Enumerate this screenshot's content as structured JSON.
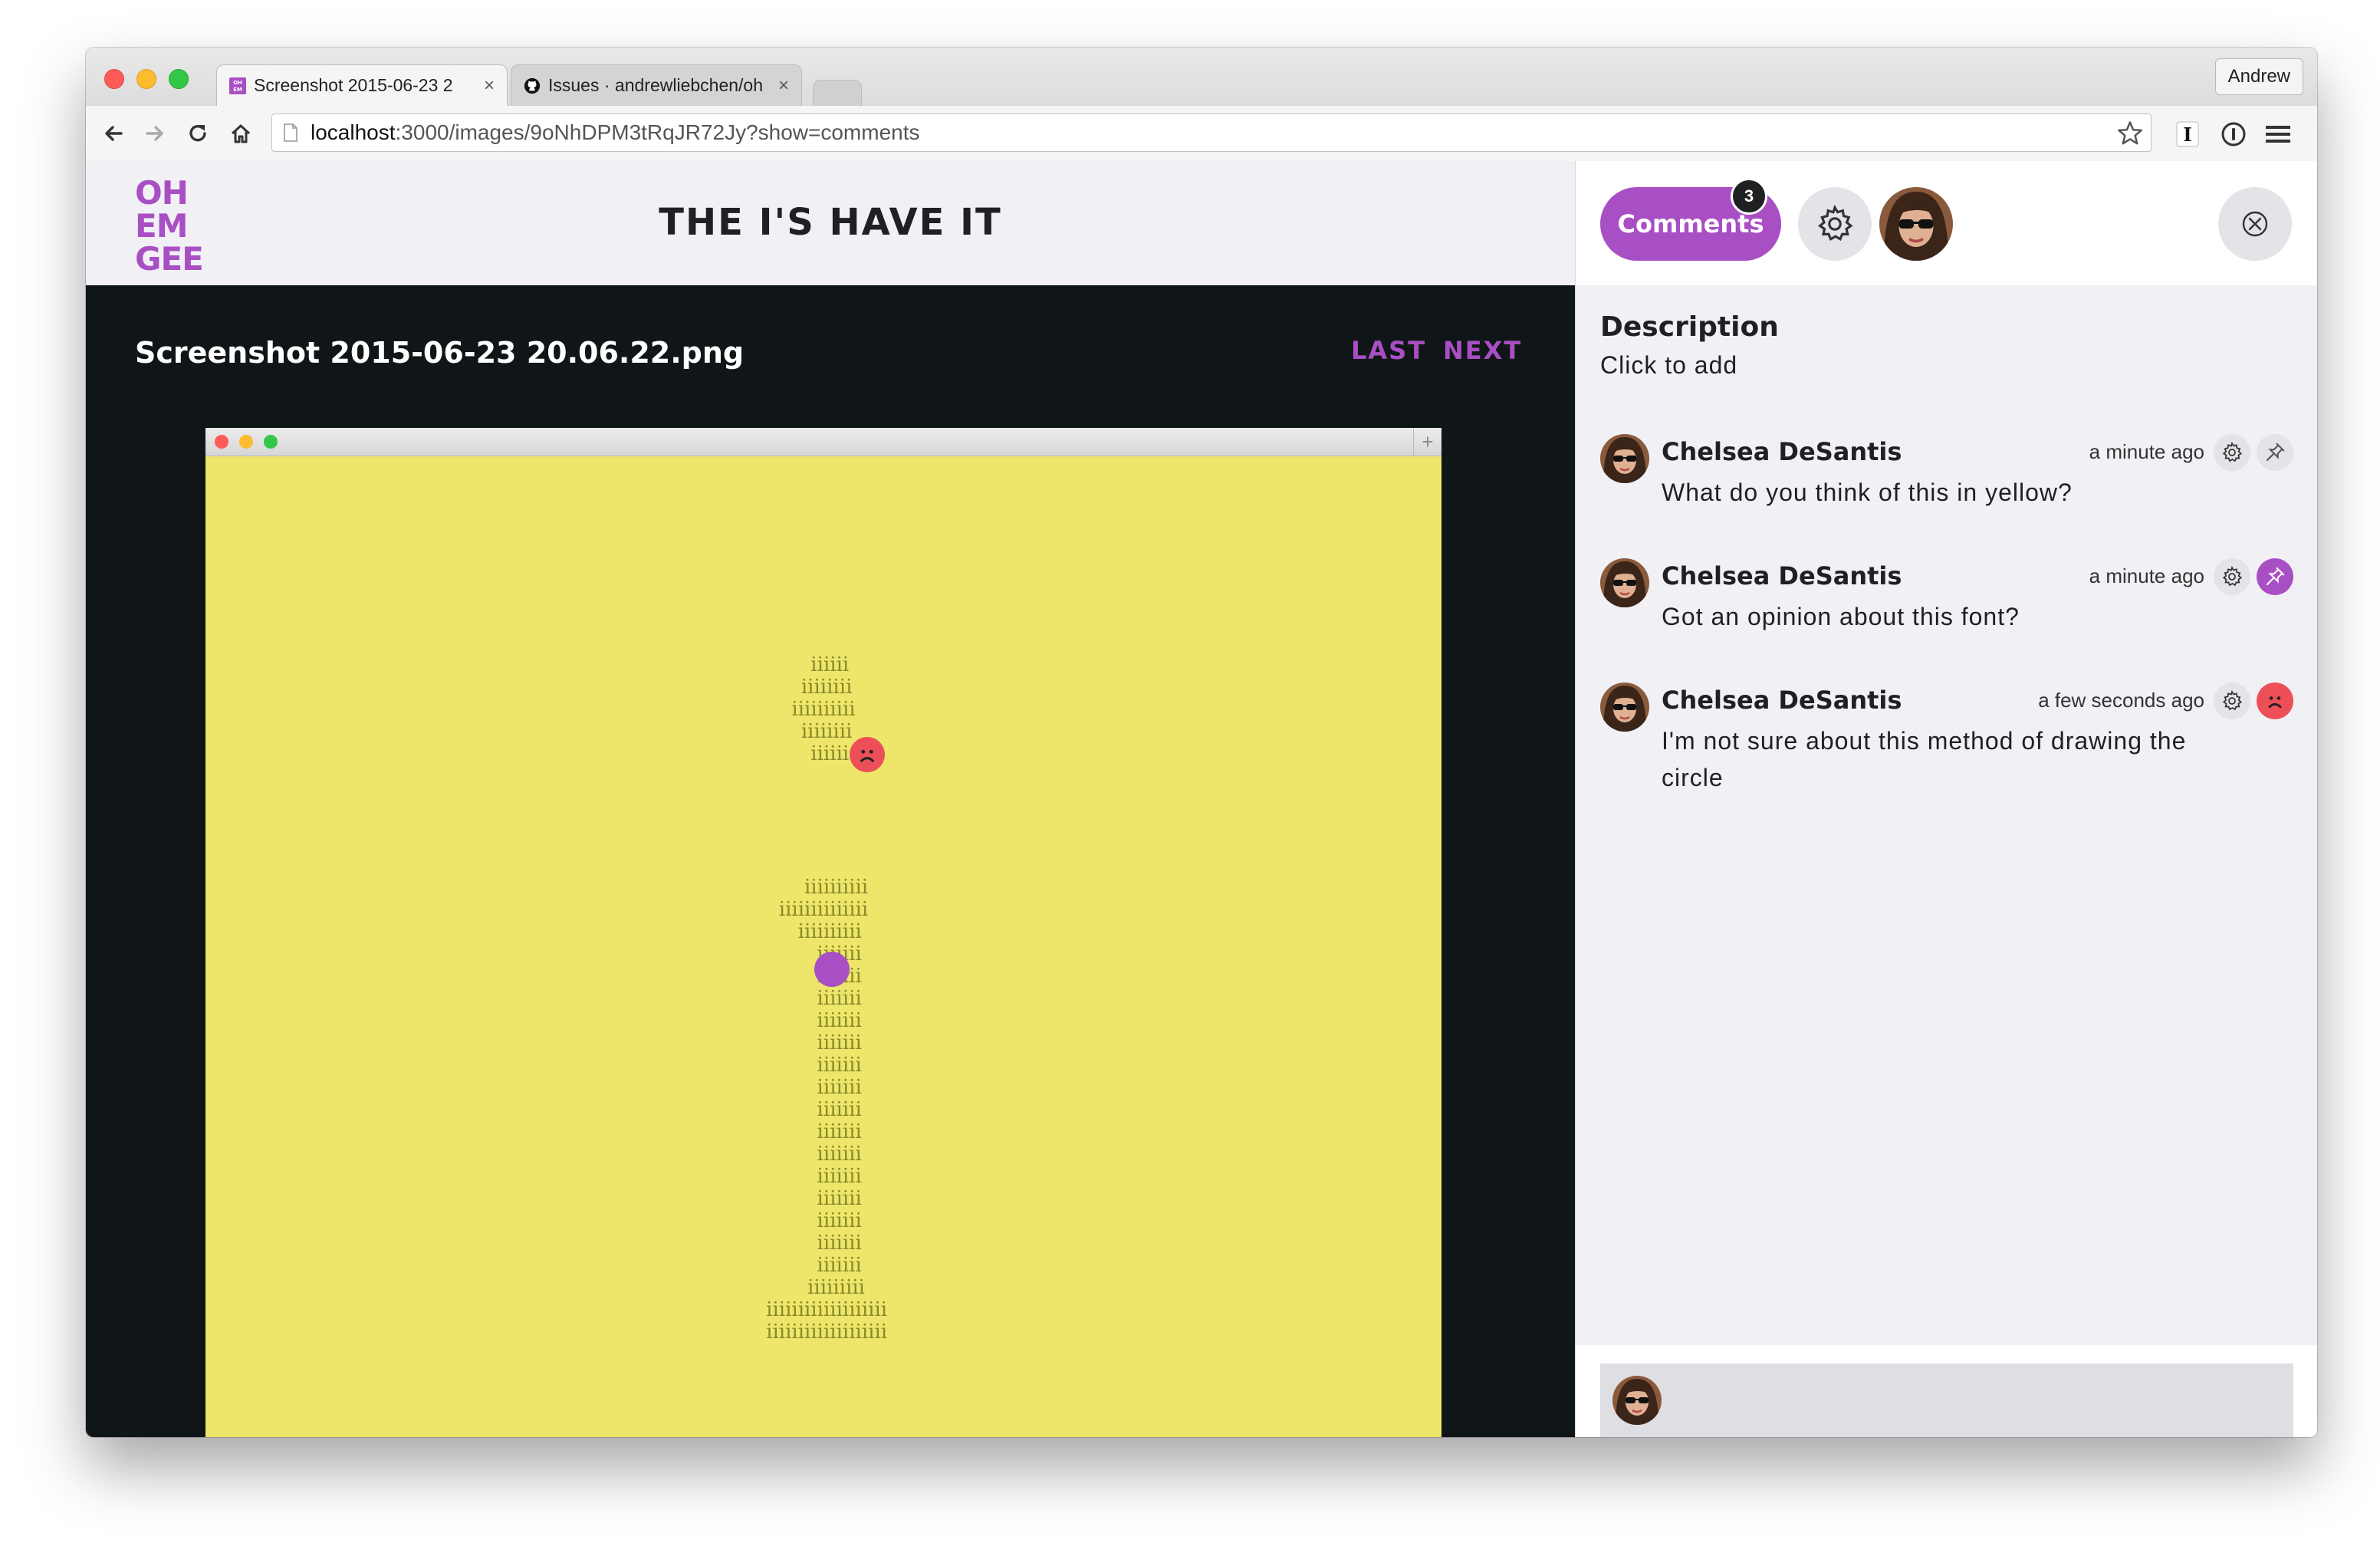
{
  "browser": {
    "tabs": [
      {
        "title": "Screenshot 2015-06-23 2",
        "active": true
      },
      {
        "title": "Issues · andrewliebchen/oh",
        "active": false
      }
    ],
    "close_glyph": "×",
    "profile_name": "Andrew",
    "url_host": "localhost",
    "url_rest": ":3000/images/9oNhDPM3tRqJR72Jy?show=comments",
    "icons": [
      "back-icon",
      "forward-icon",
      "reload-icon",
      "home-icon",
      "page-icon",
      "star-icon",
      "instapaper-icon",
      "1password-icon",
      "menu-icon"
    ]
  },
  "app": {
    "logo": [
      "OH",
      "EM",
      "GEE"
    ],
    "title": "THE I'S HAVE IT",
    "accent_color": "#a94fc4",
    "alert_color": "#ec4f58"
  },
  "viewer": {
    "filename": "Screenshot 2015-06-23 20.06.22.png",
    "last_label": "LAST",
    "next_label": "NEXT",
    "plus_glyph": "+",
    "background_color": "#ede66a",
    "ascii_dot": "  iiiiii\n iiiiiiii\niiiiiiiiii\n iiiiiiii\n  iiiiii",
    "ascii_stem": "    iiiiiiiiii\niiiiiiiiiiiiii\n  iiiiiiiiii\n     iiiiiii\n     iiiiiii\n     iiiiiii\n     iiiiiii\n     iiiiiii\n     iiiiiii\n     iiiiiii\n     iiiiiii\n     iiiiiii\n     iiiiiii\n     iiiiiii\n     iiiiiii\n     iiiiiii\n     iiiiiii\n     iiiiiii\n    iiiiiiiii\n iiiiiiiiiiiiiiiiiii\n iiiiiiiiiiiiiiiiiii"
  },
  "panel": {
    "comments_label": "Comments",
    "comments_count": "3",
    "description_heading": "Description",
    "description_value": "Click to add",
    "comments": [
      {
        "author": "Chelsea DeSantis",
        "time": "a minute ago",
        "text": "What do you think of this in yellow?",
        "marker": "pin-icon"
      },
      {
        "author": "Chelsea DeSantis",
        "time": "a minute ago",
        "text": "Got an opinion about this font?",
        "marker": "pin-icon"
      },
      {
        "author": "Chelsea DeSantis",
        "time": "a few seconds ago",
        "text": "I'm not sure about this method of drawing the circle",
        "marker": "frown-icon"
      }
    ]
  }
}
